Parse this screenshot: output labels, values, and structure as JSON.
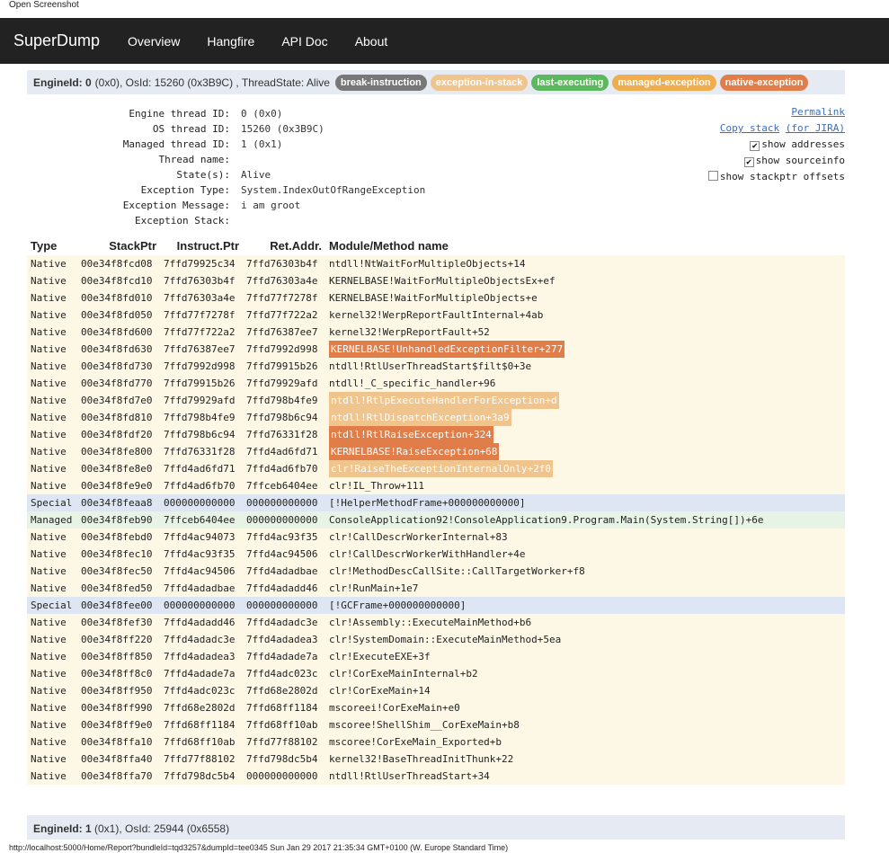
{
  "window_caption": "Open Screenshot",
  "nav": {
    "brand": "SuperDump",
    "links": [
      "Overview",
      "Hangfire",
      "API Doc",
      "About"
    ]
  },
  "thread": {
    "engine_label": "EngineId: 0",
    "header_text": "(0x0), OsId: 15260 (0x3B9C) , ThreadState: Alive",
    "tags": [
      {
        "label": "break-instruction",
        "color": "#777777"
      },
      {
        "label": "exception-in-stack",
        "color": "#f0c48d"
      },
      {
        "label": "last-executing",
        "color": "#5cb85c"
      },
      {
        "label": "managed-exception",
        "color": "#f0ad4e"
      },
      {
        "label": "native-exception",
        "color": "#e07d48"
      }
    ],
    "properties": [
      {
        "label": "Engine thread ID:",
        "value": "0 (0x0)"
      },
      {
        "label": "OS thread ID:",
        "value": "15260 (0x3B9C)"
      },
      {
        "label": "Managed thread ID:",
        "value": "1 (0x1)"
      },
      {
        "label": "Thread name:",
        "value": ""
      },
      {
        "label": "State(s):",
        "value": "Alive"
      },
      {
        "label": "Exception Type:",
        "value": "System.IndexOutOfRangeException"
      },
      {
        "label": "Exception Message:",
        "value": "i am groot"
      },
      {
        "label": "Exception Stack:",
        "value": ""
      }
    ],
    "options": {
      "permalink": "Permalink",
      "copy_stack": "Copy stack",
      "for_jira": "(for JIRA)",
      "show_addresses": {
        "label": "show addresses",
        "checked": true
      },
      "show_sourceinfo": {
        "label": "show sourceinfo",
        "checked": true
      },
      "show_stackptr": {
        "label": "show stackptr offsets",
        "checked": false
      }
    }
  },
  "table": {
    "headers": [
      "Type",
      "StackPtr",
      "Instruct.Ptr",
      "Ret.Addr.",
      "Module/Method name"
    ],
    "rows": [
      {
        "type": "Native",
        "sp": "00e34f8fcd08",
        "ip": "7ffd79925c34",
        "ret": "7ffd76303b4f",
        "method": "ntdll!NtWaitForMultipleObjects+14",
        "hl": ""
      },
      {
        "type": "Native",
        "sp": "00e34f8fcd10",
        "ip": "7ffd76303b4f",
        "ret": "7ffd76303a4e",
        "method": "KERNELBASE!WaitForMultipleObjectsEx+ef",
        "hl": ""
      },
      {
        "type": "Native",
        "sp": "00e34f8fd010",
        "ip": "7ffd76303a4e",
        "ret": "7ffd77f7278f",
        "method": "KERNELBASE!WaitForMultipleObjects+e",
        "hl": ""
      },
      {
        "type": "Native",
        "sp": "00e34f8fd050",
        "ip": "7ffd77f7278f",
        "ret": "7ffd77f722a2",
        "method": "kernel32!WerpReportFaultInternal+4ab",
        "hl": ""
      },
      {
        "type": "Native",
        "sp": "00e34f8fd600",
        "ip": "7ffd77f722a2",
        "ret": "7ffd76387ee7",
        "method": "kernel32!WerpReportFault+52",
        "hl": ""
      },
      {
        "type": "Native",
        "sp": "00e34f8fd630",
        "ip": "7ffd76387ee7",
        "ret": "7ffd7992d998",
        "method": "KERNELBASE!UnhandledExceptionFilter+277",
        "hl": "native"
      },
      {
        "type": "Native",
        "sp": "00e34f8fd730",
        "ip": "7ffd7992d998",
        "ret": "7ffd79915b26",
        "method": "ntdll!RtlUserThreadStart$filt$0+3e",
        "hl": ""
      },
      {
        "type": "Native",
        "sp": "00e34f8fd770",
        "ip": "7ffd79915b26",
        "ret": "7ffd79929afd",
        "method": "ntdll!_C_specific_handler+96",
        "hl": ""
      },
      {
        "type": "Native",
        "sp": "00e34f8fd7e0",
        "ip": "7ffd79929afd",
        "ret": "7ffd798b4fe9",
        "method": "ntdll!RtlpExecuteHandlerForException+d",
        "hl": "managed"
      },
      {
        "type": "Native",
        "sp": "00e34f8fd810",
        "ip": "7ffd798b4fe9",
        "ret": "7ffd798b6c94",
        "method": "ntdll!RtlDispatchException+3a9",
        "hl": "managed"
      },
      {
        "type": "Native",
        "sp": "00e34f8fdf20",
        "ip": "7ffd798b6c94",
        "ret": "7ffd76331f28",
        "method": "ntdll!RtlRaiseException+324",
        "hl": "native"
      },
      {
        "type": "Native",
        "sp": "00e34f8fe800",
        "ip": "7ffd76331f28",
        "ret": "7ffd4ad6fd71",
        "method": "KERNELBASE!RaiseException+68",
        "hl": "native"
      },
      {
        "type": "Native",
        "sp": "00e34f8fe8e0",
        "ip": "7ffd4ad6fd71",
        "ret": "7ffd4ad6fb70",
        "method": "clr!RaiseTheExceptionInternalOnly+2f0",
        "hl": "managed"
      },
      {
        "type": "Native",
        "sp": "00e34f8fe9e0",
        "ip": "7ffd4ad6fb70",
        "ret": "7ffceb6404ee",
        "method": "clr!IL_Throw+111",
        "hl": ""
      },
      {
        "type": "Special",
        "sp": "00e34f8feaa8",
        "ip": "000000000000",
        "ret": "000000000000",
        "method": "[!HelperMethodFrame+000000000000]",
        "hl": ""
      },
      {
        "type": "Managed",
        "sp": "00e34f8feb90",
        "ip": "7ffceb6404ee",
        "ret": "000000000000",
        "method": "ConsoleApplication92!ConsoleApplication9.Program.Main(System.String[])+6e",
        "hl": ""
      },
      {
        "type": "Native",
        "sp": "00e34f8febd0",
        "ip": "7ffd4ac94073",
        "ret": "7ffd4ac93f35",
        "method": "clr!CallDescrWorkerInternal+83",
        "hl": ""
      },
      {
        "type": "Native",
        "sp": "00e34f8fec10",
        "ip": "7ffd4ac93f35",
        "ret": "7ffd4ac94506",
        "method": "clr!CallDescrWorkerWithHandler+4e",
        "hl": ""
      },
      {
        "type": "Native",
        "sp": "00e34f8fec50",
        "ip": "7ffd4ac94506",
        "ret": "7ffd4adadbae",
        "method": "clr!MethodDescCallSite::CallTargetWorker+f8",
        "hl": ""
      },
      {
        "type": "Native",
        "sp": "00e34f8fed50",
        "ip": "7ffd4adadbae",
        "ret": "7ffd4adadd46",
        "method": "clr!RunMain+1e7",
        "hl": ""
      },
      {
        "type": "Special",
        "sp": "00e34f8fee00",
        "ip": "000000000000",
        "ret": "000000000000",
        "method": "[!GCFrame+000000000000]",
        "hl": ""
      },
      {
        "type": "Native",
        "sp": "00e34f8fef30",
        "ip": "7ffd4adadd46",
        "ret": "7ffd4adadc3e",
        "method": "clr!Assembly::ExecuteMainMethod+b6",
        "hl": ""
      },
      {
        "type": "Native",
        "sp": "00e34f8ff220",
        "ip": "7ffd4adadc3e",
        "ret": "7ffd4adadea3",
        "method": "clr!SystemDomain::ExecuteMainMethod+5ea",
        "hl": ""
      },
      {
        "type": "Native",
        "sp": "00e34f8ff850",
        "ip": "7ffd4adadea3",
        "ret": "7ffd4adade7a",
        "method": "clr!ExecuteEXE+3f",
        "hl": ""
      },
      {
        "type": "Native",
        "sp": "00e34f8ff8c0",
        "ip": "7ffd4adade7a",
        "ret": "7ffd4adc023c",
        "method": "clr!CorExeMainInternal+b2",
        "hl": ""
      },
      {
        "type": "Native",
        "sp": "00e34f8ff950",
        "ip": "7ffd4adc023c",
        "ret": "7ffd68e2802d",
        "method": "clr!CorExeMain+14",
        "hl": ""
      },
      {
        "type": "Native",
        "sp": "00e34f8ff990",
        "ip": "7ffd68e2802d",
        "ret": "7ffd68ff1184",
        "method": "mscoreei!CorExeMain+e0",
        "hl": ""
      },
      {
        "type": "Native",
        "sp": "00e34f8ff9e0",
        "ip": "7ffd68ff1184",
        "ret": "7ffd68ff10ab",
        "method": "mscoree!ShellShim__CorExeMain+b8",
        "hl": ""
      },
      {
        "type": "Native",
        "sp": "00e34f8ffa10",
        "ip": "7ffd68ff10ab",
        "ret": "7ffd77f88102",
        "method": "mscoree!CorExeMain_Exported+b",
        "hl": ""
      },
      {
        "type": "Native",
        "sp": "00e34f8ffa40",
        "ip": "7ffd77f88102",
        "ret": "7ffd798dc5b4",
        "method": "kernel32!BaseThreadInitThunk+22",
        "hl": ""
      },
      {
        "type": "Native",
        "sp": "00e34f8ffa70",
        "ip": "7ffd798dc5b4",
        "ret": "000000000000",
        "method": "ntdll!RtlUserThreadStart+34",
        "hl": ""
      }
    ]
  },
  "next_thread": {
    "engine_label": "EngineId: 1",
    "header_text": "(0x1), OsId: 25944 (0x6558)"
  },
  "status_bar": "http://localhost:5000/Home/Report?bundleId=tqd3257&dumpId=tee0345 Sun Jan 29 2017 21:35:34 GMT+0100 (W. Europe Standard Time)"
}
